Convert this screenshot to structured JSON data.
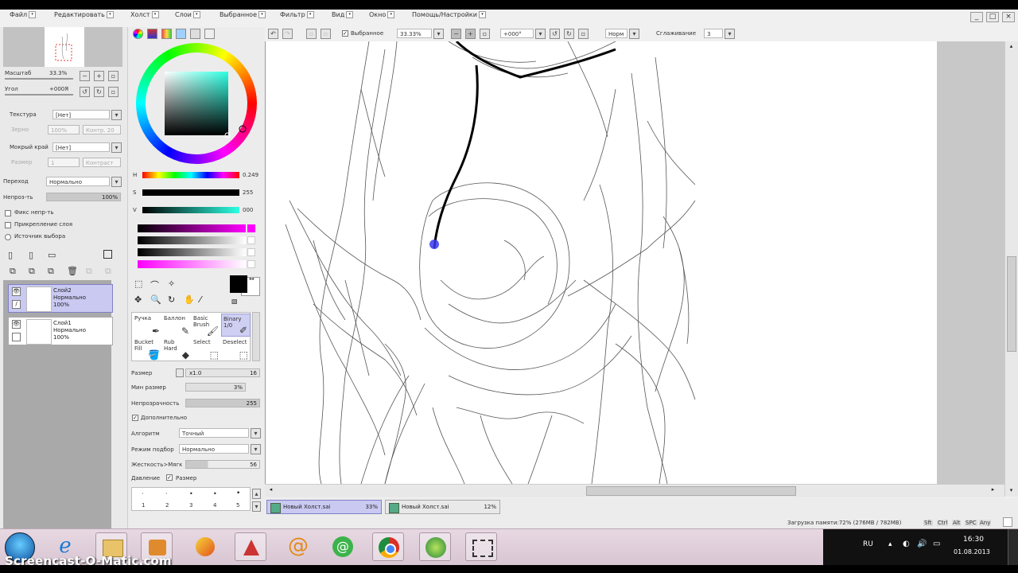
{
  "menu": [
    "Файл",
    "Редактировать",
    "Холст",
    "Слои",
    "Выбранное",
    "Фильтр",
    "Вид",
    "Окно",
    "Помощь/Настройки"
  ],
  "navigator": {
    "zoom_label": "Масштаб",
    "zoom_value": "33.3%",
    "angle_label": "Угол",
    "angle_value": "+000Я"
  },
  "texture": {
    "label": "Текстура",
    "value": "[Нет]",
    "grain_label": "Зерно",
    "grain_value": "100%",
    "grain2_label": "Контр. 20"
  },
  "wet": {
    "label": "Мокрый край",
    "value": "[Нет]",
    "size_label": "Размер",
    "size_value": "1",
    "contrast_label": "Контраст"
  },
  "blend": {
    "label": "Переход",
    "value": "Нормально"
  },
  "opacity": {
    "label": "Непроз-ть",
    "value": "100%"
  },
  "checks": {
    "fix": "Фикс непр-ть",
    "clip": "Прикрепление слоя",
    "source": "Источник выбора"
  },
  "layers": [
    {
      "name": "Слой2",
      "mode": "Нормально",
      "opacity": "100%"
    },
    {
      "name": "Слой1",
      "mode": "Нормально",
      "opacity": "100%"
    }
  ],
  "colorbars": {
    "h": "H",
    "h_val": "0.249",
    "s": "S",
    "s_val": "255",
    "v": "V",
    "v_val": "000"
  },
  "tools": [
    {
      "label": "Ручка",
      "icon": "pen-icon"
    },
    {
      "label": "Баллон",
      "icon": "airbrush-icon"
    },
    {
      "label": "Basic Brush",
      "icon": "brush-icon"
    },
    {
      "label": "Binary 1/0",
      "icon": "binary-pen-icon"
    },
    {
      "label": "Bucket Fill",
      "icon": "bucket-icon"
    },
    {
      "label": "Rub Hard",
      "icon": "eraser-icon"
    },
    {
      "label": "Select",
      "icon": "select-icon"
    },
    {
      "label": "Deselect",
      "icon": "deselect-icon"
    }
  ],
  "brush": {
    "size_label": "Размер",
    "size_mult": "x1.0",
    "size_value": "16",
    "min_label": "Мин размер",
    "min_value": "3%",
    "opacity_label": "Непрозрачность",
    "opacity_value": "255",
    "extra_label": "Дополнительно",
    "algo_label": "Алгоритм",
    "algo_value": "Точный",
    "mode_label": "Режим подбор",
    "mode_value": "Нормально",
    "hard_label": "Жесткость>Мягк",
    "hard_value": "56",
    "pressure_label": "Давление",
    "pressure_check": "Размер"
  },
  "size_presets": [
    "1",
    "2",
    "3",
    "4",
    "5"
  ],
  "toolbar": {
    "selected_label": "Выбранное",
    "zoom": "33.33%",
    "angle": "+000°",
    "mode": "Норм",
    "smooth_label": "Сглаживание",
    "smooth_value": "3"
  },
  "doc_tabs": [
    {
      "name": "Новый Холст.sai",
      "zoom": "33%"
    },
    {
      "name": "Новый Холст.sai",
      "zoom": "12%"
    }
  ],
  "status": {
    "memory": "Загрузка памяти:72% (276MB / 782MB)",
    "keys": [
      "Sft",
      "Ctrl",
      "Alt",
      "SPC",
      "Any"
    ]
  },
  "tray": {
    "lang": "RU",
    "time": "16:30",
    "date": "01.08.2013"
  },
  "watermark": "Screencast-O-Matic.com",
  "taskbar_apps": [
    "start-orb-icon",
    "internet-explorer-icon",
    "file-explorer-icon",
    "media-player-icon",
    "paint-tool-sai-icon",
    "app-icon",
    "mail-agent-icon",
    "icq-icon",
    "chrome-icon",
    "image-viewer-icon",
    "screen-recorder-icon"
  ]
}
